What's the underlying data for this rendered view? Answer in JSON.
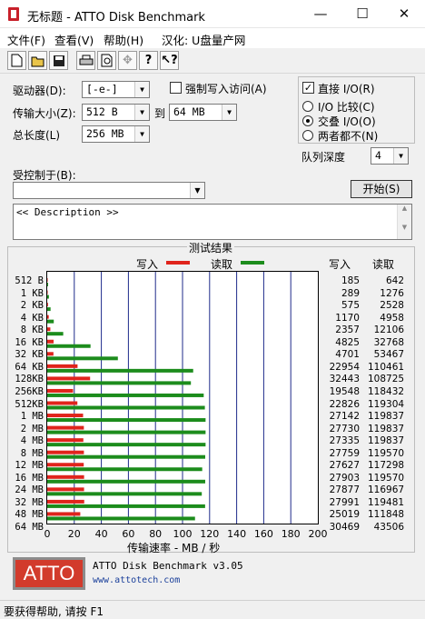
{
  "window": {
    "title": "无标题 - ATTO Disk Benchmark",
    "minimize": "—",
    "maximize": "☐",
    "close": "✕"
  },
  "menu": [
    "文件(F)",
    "查看(V)",
    "帮助(H)",
    "汉化: U盘量产网"
  ],
  "toolbar": [
    "new-icon",
    "open-icon",
    "save-icon",
    "print-icon",
    "print-preview-icon",
    "move-icon",
    "help-icon",
    "context-help-icon"
  ],
  "settings": {
    "drive_label": "驱动器(D):",
    "drive_value": "[-e-]",
    "transfer_label": "传输大小(Z):",
    "transfer_from": "512 B",
    "to_label": "到",
    "transfer_to": "64 MB",
    "length_label": "总长度(L)",
    "length_value": "256 MB",
    "force_write_label": "强制写入访问(A)",
    "direct_io_label": "直接 I/O(R)",
    "io_compare_label": "I/O 比较(C)",
    "overlapped_io_label": "交叠 I/O(O)",
    "neither_label": "两者都不(N)",
    "queue_label": "队列深度",
    "queue_value": "4",
    "controlled_by_label": "受控制于(B):",
    "controlled_by_value": "",
    "start_button": "开始(S)",
    "description": "<< Description >>"
  },
  "results": {
    "title": "测试结果",
    "write_legend": "写入",
    "read_legend": "读取",
    "col_write": "写入",
    "col_read": "读取",
    "xlabel": "传输速率 - MB / 秒"
  },
  "colors": {
    "write": "#e0241c",
    "read": "#1c8c1c",
    "logo": "#d23b2c"
  },
  "chart_data": {
    "type": "bar",
    "orientation": "horizontal",
    "categories": [
      "512 B",
      "1 KB",
      "2 KB",
      "4 KB",
      "8 KB",
      "16 KB",
      "32 KB",
      "64 KB",
      "128KB",
      "256KB",
      "512KB",
      "1 MB",
      "2 MB",
      "4 MB",
      "8 MB",
      "12 MB",
      "16 MB",
      "24 MB",
      "32 MB",
      "48 MB",
      "64 MB"
    ],
    "series": [
      {
        "name": "写入",
        "values": [
          185,
          289,
          575,
          1170,
          2357,
          4825,
          4701,
          22954,
          32443,
          19548,
          22826,
          27142,
          27730,
          27335,
          27759,
          27627,
          27903,
          27877,
          27991,
          25019,
          30469
        ]
      },
      {
        "name": "读取",
        "values": [
          642,
          1276,
          2528,
          4958,
          12106,
          32768,
          53467,
          110461,
          108725,
          118432,
          119304,
          119837,
          119837,
          119837,
          119570,
          117298,
          119570,
          116967,
          119481,
          111848,
          43506
        ]
      }
    ],
    "units": "KB/s",
    "xlabel": "传输速率 - MB / 秒",
    "xlim": [
      0,
      200
    ],
    "xticks": [
      0,
      20,
      40,
      60,
      80,
      100,
      120,
      140,
      160,
      180,
      200
    ],
    "grid": true
  },
  "footer": {
    "logo_text": "ATTO",
    "product": "ATTO Disk Benchmark v3.05",
    "url": "www.attotech.com"
  },
  "status": "要获得帮助, 请按 F1"
}
